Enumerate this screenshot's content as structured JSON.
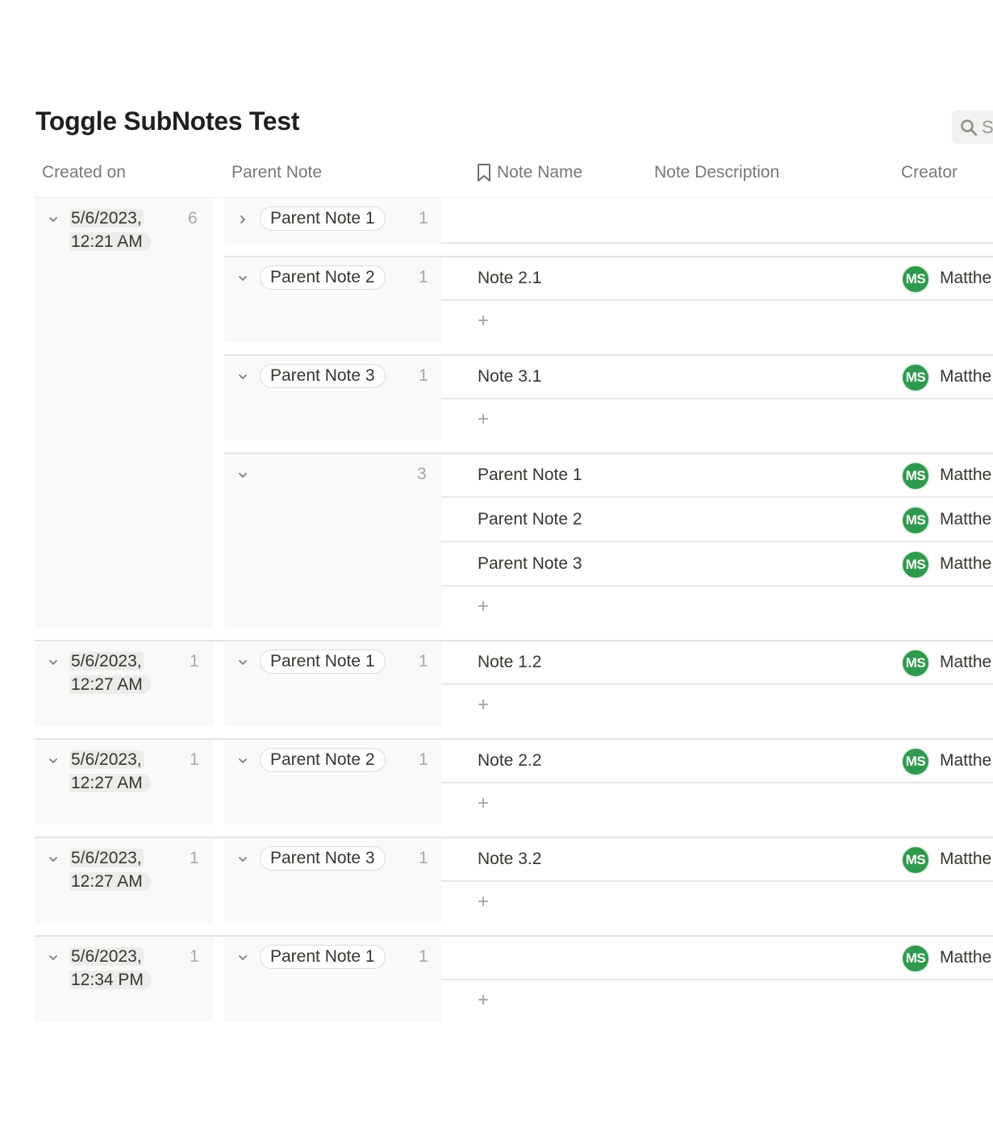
{
  "page": {
    "title": "Toggle SubNotes Test"
  },
  "search": {
    "icon": "search-icon",
    "label": "S"
  },
  "columns": {
    "created_on": "Created on",
    "parent_note": "Parent Note",
    "note_name": "Note Name",
    "note_name_icon": "bookmark-icon",
    "note_description": "Note Description",
    "creator": "Creator"
  },
  "avatar_color": "#2f9a4e",
  "groups": [
    {
      "date_line1": "5/6/2023,",
      "date_line2": "12:21 AM",
      "count": "6",
      "subgroups": [
        {
          "parent": "Parent Note 1",
          "count": "1",
          "expanded": false,
          "rows": []
        },
        {
          "parent": "Parent Note 2",
          "count": "1",
          "expanded": true,
          "rows": [
            {
              "name": "Note 2.1",
              "initials": "MS",
              "creator": "Matthe"
            }
          ]
        },
        {
          "parent": "Parent Note 3",
          "count": "1",
          "expanded": true,
          "rows": [
            {
              "name": "Note 3.1",
              "initials": "MS",
              "creator": "Matthe"
            }
          ]
        },
        {
          "parent": "",
          "count": "3",
          "expanded": true,
          "rows": [
            {
              "name": "Parent Note 1",
              "initials": "MS",
              "creator": "Matthe"
            },
            {
              "name": "Parent Note 2",
              "initials": "MS",
              "creator": "Matthe"
            },
            {
              "name": "Parent Note 3",
              "initials": "MS",
              "creator": "Matthe"
            }
          ]
        }
      ]
    },
    {
      "date_line1": "5/6/2023,",
      "date_line2": "12:27 AM",
      "count": "1",
      "subgroups": [
        {
          "parent": "Parent Note 1",
          "count": "1",
          "expanded": true,
          "rows": [
            {
              "name": "Note 1.2",
              "initials": "MS",
              "creator": "Matthe"
            }
          ]
        }
      ]
    },
    {
      "date_line1": "5/6/2023,",
      "date_line2": "12:27 AM",
      "count": "1",
      "subgroups": [
        {
          "parent": "Parent Note 2",
          "count": "1",
          "expanded": true,
          "rows": [
            {
              "name": "Note 2.2",
              "initials": "MS",
              "creator": "Matthe"
            }
          ]
        }
      ]
    },
    {
      "date_line1": "5/6/2023,",
      "date_line2": "12:27 AM",
      "count": "1",
      "subgroups": [
        {
          "parent": "Parent Note 3",
          "count": "1",
          "expanded": true,
          "rows": [
            {
              "name": "Note 3.2",
              "initials": "MS",
              "creator": "Matthe"
            }
          ]
        }
      ]
    },
    {
      "date_line1": "5/6/2023,",
      "date_line2": "12:34 PM",
      "count": "1",
      "subgroups": [
        {
          "parent": "Parent Note 1",
          "count": "1",
          "expanded": true,
          "rows": [
            {
              "name": "",
              "initials": "MS",
              "creator": "Matthe"
            }
          ]
        }
      ]
    }
  ],
  "add_label": "+"
}
